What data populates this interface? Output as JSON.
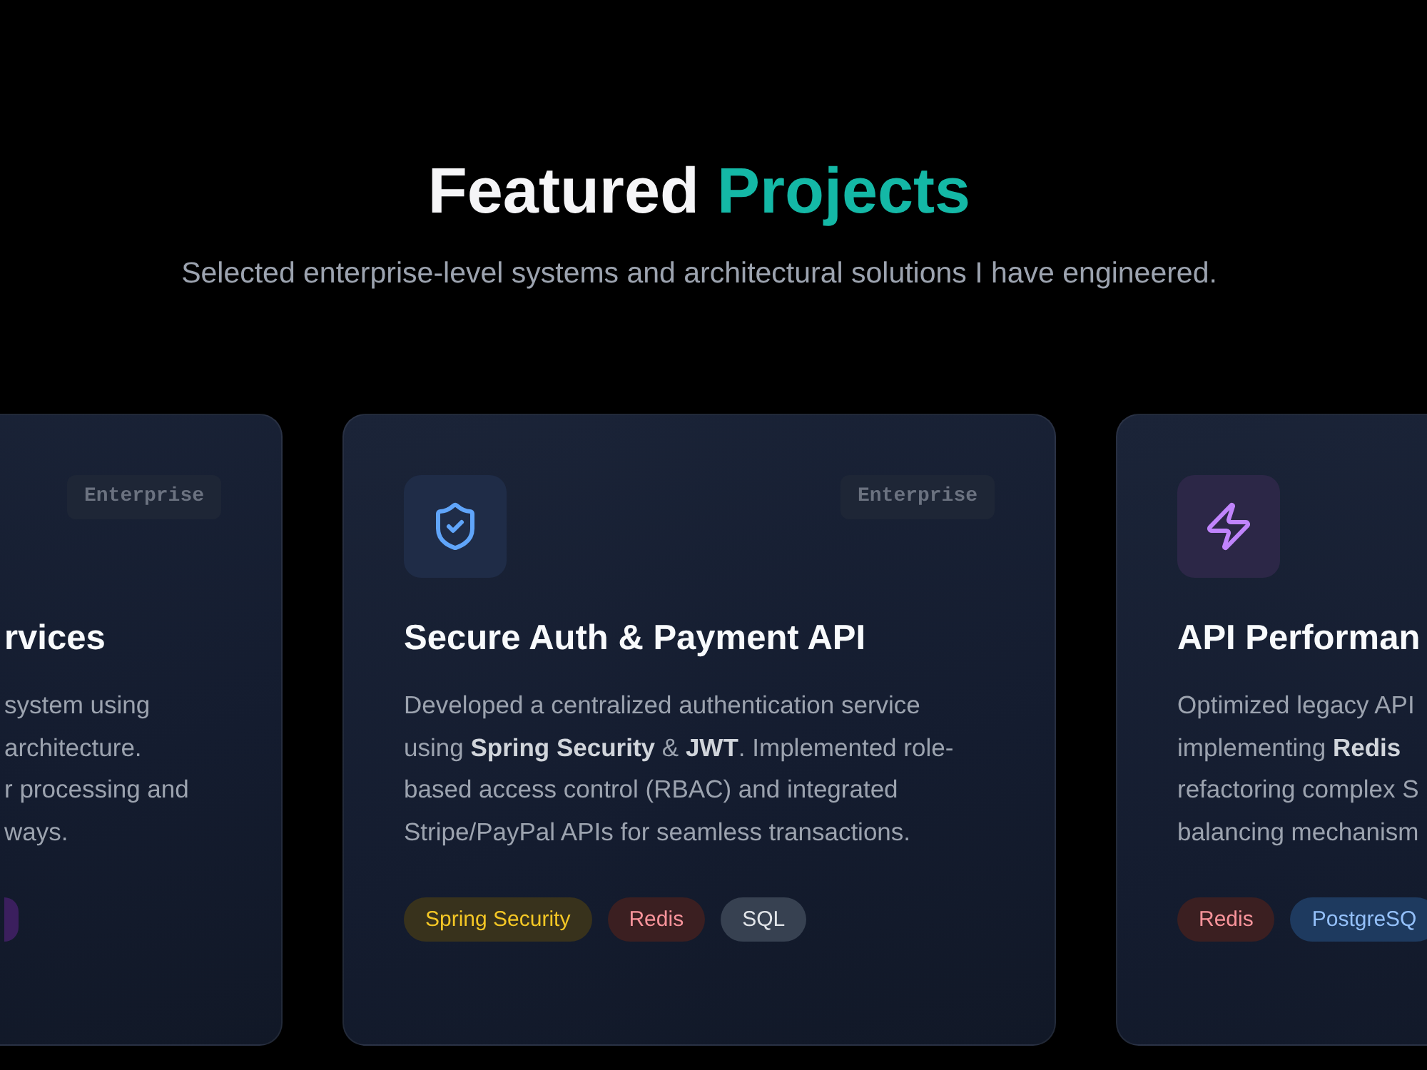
{
  "header": {
    "title": "Featured",
    "title_accent": "Projects",
    "subtitle": "Selected enterprise-level systems and architectural solutions I have engineered."
  },
  "cards": [
    {
      "badge": "Enterprise",
      "title": "rvices",
      "description": [
        "system using",
        "architecture.",
        "r processing and",
        "ways."
      ],
      "tags": [
        {
          "color": "#3b1f5e"
        }
      ]
    },
    {
      "color": "#60a5fa",
      "badge": "Enterprise",
      "title": "Secure Auth & Payment API",
      "description": "Developed a centralized authentication service using **Spring Security** & **JWT**. Implemented role-based access control (RBAC) and integrated Stripe/PayPal APIs for seamless transactions.",
      "tags": [
        {
          "label": "Spring Security",
          "color": "#38321c"
        },
        {
          "label": "Redis",
          "color": "#3b1f21"
        },
        {
          "label": "SQL",
          "color": "#374151"
        }
      ]
    },
    {
      "color": "#c084fc",
      "title": "API Performan",
      "description": [
        "Optimized legacy API",
        "implementing **Redis**",
        "refactoring complex S",
        "balancing mechanism"
      ],
      "tags": [
        {
          "label": "Redis",
          "color": "#3b1f21"
        },
        {
          "label": "PostgreSQ",
          "color": "#1e3a5f"
        }
      ]
    }
  ]
}
